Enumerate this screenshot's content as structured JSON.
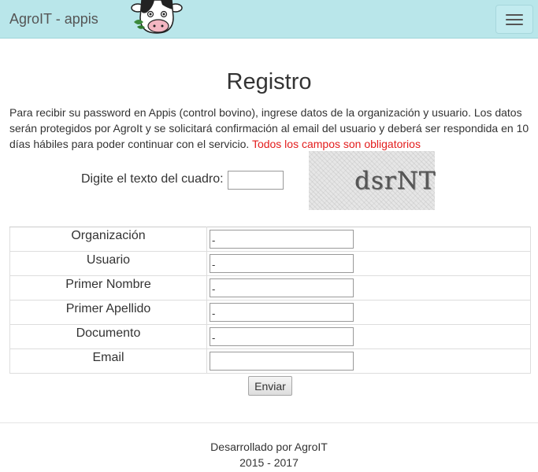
{
  "navbar": {
    "brand": "AgroIT - appis",
    "logo_icon": "cow-logo-icon",
    "menu_icon": "hamburger-menu-icon",
    "background": "#b9e6ea"
  },
  "page": {
    "title": "Registro",
    "intro": "Para recibir su password en Appis (control bovino), ingrese datos de la organización y usuario. Los datos serán protegidos por AgroIt y se solicitará confirmación al email del usuario y deberá ser respondida en 10 días hábiles para poder continuar con el servicio.",
    "required_note": "Todos los campos son obligatorios",
    "required_color": "#e31c1c"
  },
  "captcha": {
    "label": "Digite el texto del cuadro:",
    "value": "",
    "image_text": "dsrNT"
  },
  "form": {
    "fields": [
      {
        "label": "Organización",
        "value": "-"
      },
      {
        "label": "Usuario",
        "value": "-"
      },
      {
        "label": "Primer Nombre",
        "value": "-"
      },
      {
        "label": "Primer Apellido",
        "value": "-"
      },
      {
        "label": "Documento",
        "value": "-"
      },
      {
        "label": "Email",
        "value": ""
      }
    ],
    "submit_label": "Enviar"
  },
  "footer": {
    "credit": "Desarrollado por AgroIT",
    "years": "2015 - 2017"
  }
}
